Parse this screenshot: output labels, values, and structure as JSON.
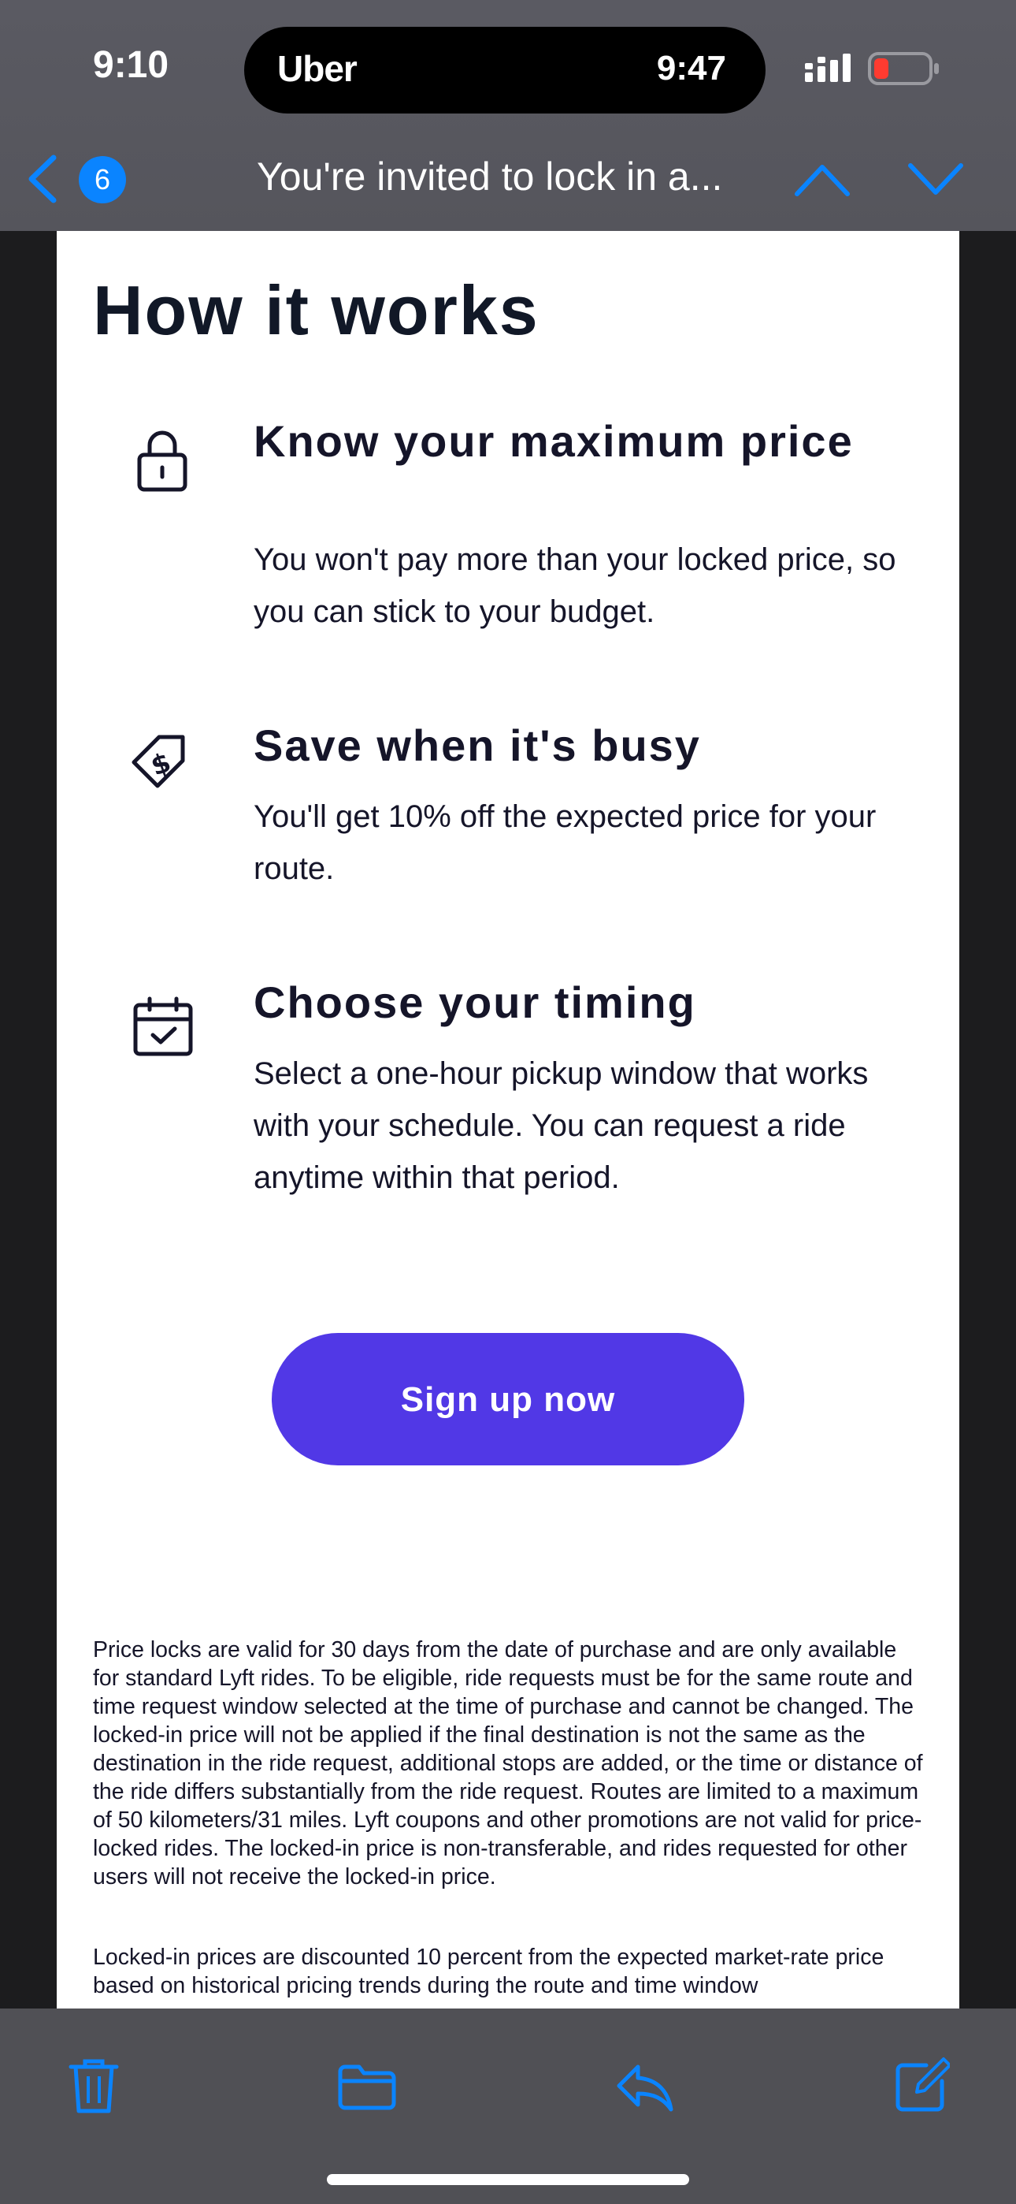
{
  "status_bar": {
    "time": "9:10",
    "island_app": "Uber",
    "island_time": "9:47"
  },
  "nav": {
    "unread_count": "6",
    "title": "You're invited to lock in a..."
  },
  "email": {
    "heading": "How it works",
    "features": [
      {
        "icon": "lock-icon",
        "title": "Know your maximum price",
        "body": "You won't pay more than your locked price, so you can stick to your budget."
      },
      {
        "icon": "dollar-tag-icon",
        "title": "Save when it's busy",
        "body": "You'll get 10% off the expected price for your route."
      },
      {
        "icon": "calendar-check-icon",
        "title": "Choose your timing",
        "body": "Select a one-hour pickup window that works with your schedule. You can request a ride anytime within that period."
      }
    ],
    "cta_label": "Sign up now",
    "legal_1": "Price locks are valid for 30 days from the date of purchase and are only available for standard Lyft rides. To be eligible, ride requests must be for the same route and time request window selected at the time of purchase and cannot be changed. The locked-in price will not be applied if the final destination is not the same as the destination in the ride request, additional stops are added, or the time or distance of the ride differs substantially from the ride request. Routes are limited to a maximum of 50 kilometers/31 miles. Lyft coupons and other promotions are not valid for price-locked rides. The locked-in price is non-transferable, and rides requested for other users will not receive the locked-in price.",
    "legal_2": "Locked-in prices are discounted 10 percent from the expected market-rate price based on historical pricing trends during the route and time window"
  },
  "toolbar": {
    "items": [
      "trash-icon",
      "folder-icon",
      "reply-icon",
      "compose-icon"
    ]
  },
  "colors": {
    "accent": "#0a84ff",
    "cta": "#5138e6",
    "text": "#151529",
    "battery_low": "#ff3b30"
  }
}
